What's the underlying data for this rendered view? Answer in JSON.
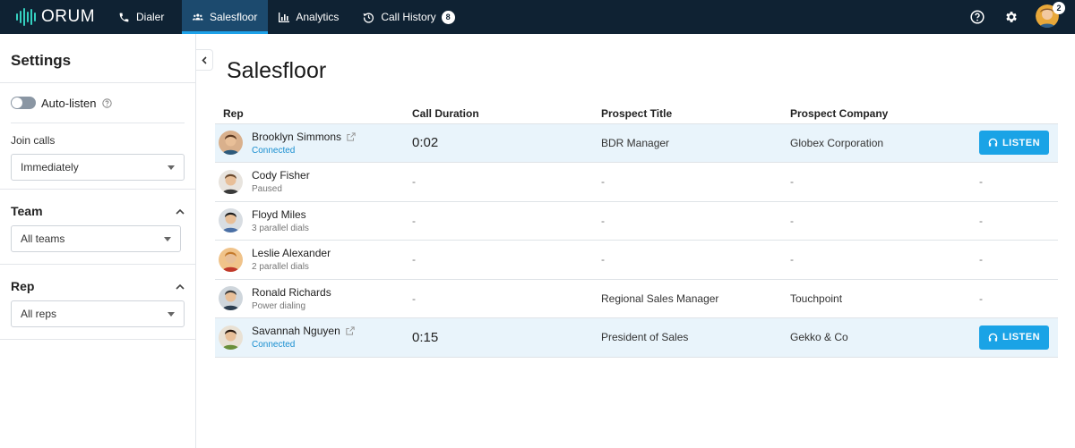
{
  "brand": {
    "name": "ORUM",
    "accent": "#35d0c0"
  },
  "nav": {
    "items": [
      {
        "label": "Dialer",
        "icon": "phone-icon"
      },
      {
        "label": "Salesfloor",
        "icon": "users-icon",
        "active": true
      },
      {
        "label": "Analytics",
        "icon": "bar-chart-icon"
      },
      {
        "label": "Call History",
        "icon": "history-icon",
        "badge": "8"
      }
    ],
    "avatar_badge": "2"
  },
  "sidebar": {
    "title": "Settings",
    "auto_listen": {
      "label": "Auto-listen",
      "on": false
    },
    "join_calls": {
      "label": "Join calls",
      "value": "Immediately"
    },
    "team": {
      "label": "Team",
      "value": "All teams"
    },
    "rep": {
      "label": "Rep",
      "value": "All reps"
    }
  },
  "main": {
    "title": "Salesfloor",
    "columns": [
      "Rep",
      "Call Duration",
      "Prospect Title",
      "Prospect Company"
    ],
    "listen_label": "LISTEN",
    "rows": [
      {
        "name": "Brooklyn Simmons",
        "status": "Connected",
        "duration": "0:02",
        "title": "BDR Manager",
        "company": "Globex Corporation",
        "action": "LISTEN"
      },
      {
        "name": "Cody Fisher",
        "status": "Paused",
        "duration": "-",
        "title": "-",
        "company": "-",
        "action": "-"
      },
      {
        "name": "Floyd Miles",
        "status": "3 parallel dials",
        "duration": "-",
        "title": "-",
        "company": "-",
        "action": "-"
      },
      {
        "name": "Leslie Alexander",
        "status": "2 parallel dials",
        "duration": "-",
        "title": "-",
        "company": "-",
        "action": "-"
      },
      {
        "name": "Ronald Richards",
        "status": "Power dialing",
        "duration": "-",
        "title": "Regional Sales Manager",
        "company": "Touchpoint",
        "action": "-"
      },
      {
        "name": "Savannah Nguyen",
        "status": "Connected",
        "duration": "0:15",
        "title": "President of Sales",
        "company": "Gekko & Co",
        "action": "LISTEN"
      }
    ]
  },
  "colors": {
    "nav_bg": "#0f2233",
    "nav_active": "#1c4a6e",
    "primary": "#1aa3e6",
    "highlight_row": "#e9f4fb"
  }
}
